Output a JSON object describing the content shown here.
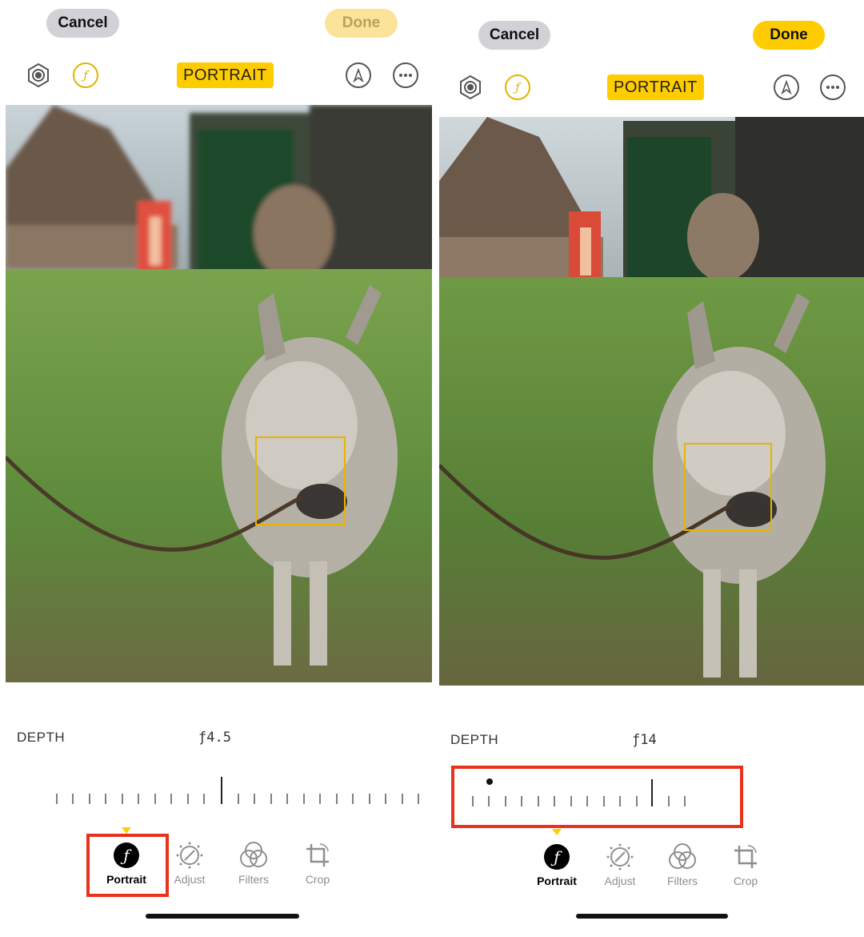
{
  "left": {
    "cancel_label": "Cancel",
    "done_label": "Done",
    "mode_badge": "PORTRAIT",
    "depth_label": "DEPTH",
    "depth_value": "ƒ4.5",
    "tabs": [
      {
        "label": "Portrait",
        "icon": "aperture-f-icon",
        "active": true
      },
      {
        "label": "Adjust",
        "icon": "adjust-dial-icon",
        "active": false
      },
      {
        "label": "Filters",
        "icon": "filters-circles-icon",
        "active": false
      },
      {
        "label": "Crop",
        "icon": "crop-rotate-icon",
        "active": false
      }
    ]
  },
  "right": {
    "cancel_label": "Cancel",
    "done_label": "Done",
    "mode_badge": "PORTRAIT",
    "depth_label": "DEPTH",
    "depth_value": "ƒ14",
    "tabs": [
      {
        "label": "Portrait",
        "icon": "aperture-f-icon",
        "active": true
      },
      {
        "label": "Adjust",
        "icon": "adjust-dial-icon",
        "active": false
      },
      {
        "label": "Filters",
        "icon": "filters-circles-icon",
        "active": false
      },
      {
        "label": "Crop",
        "icon": "crop-rotate-icon",
        "active": false
      }
    ]
  },
  "colors": {
    "accent": "#ffcc00",
    "highlight": "#e8321c",
    "cancel_bg": "#d1d1d6"
  }
}
